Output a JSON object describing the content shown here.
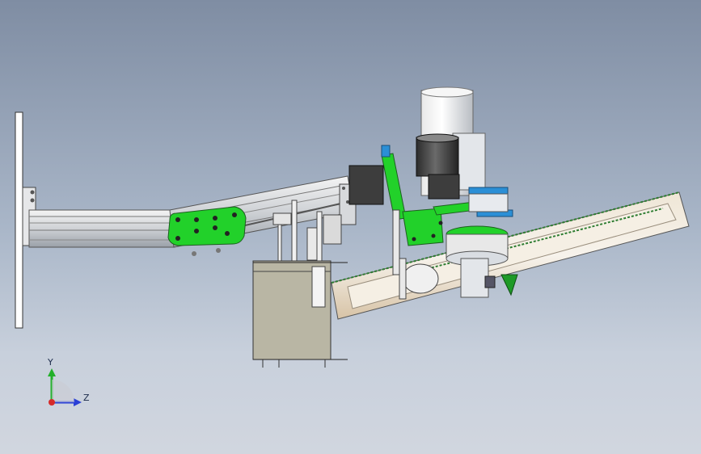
{
  "view": {
    "triad": {
      "y_label": "Y",
      "z_label": "Z"
    },
    "colors": {
      "background_top": "#7f8da3",
      "background_bottom": "#d1d6df",
      "green_parts": "#22d12a",
      "blue_parts": "#2b8fd6",
      "motor_dark": "#3d3d3d",
      "box_fill": "#b9b6a4"
    }
  }
}
